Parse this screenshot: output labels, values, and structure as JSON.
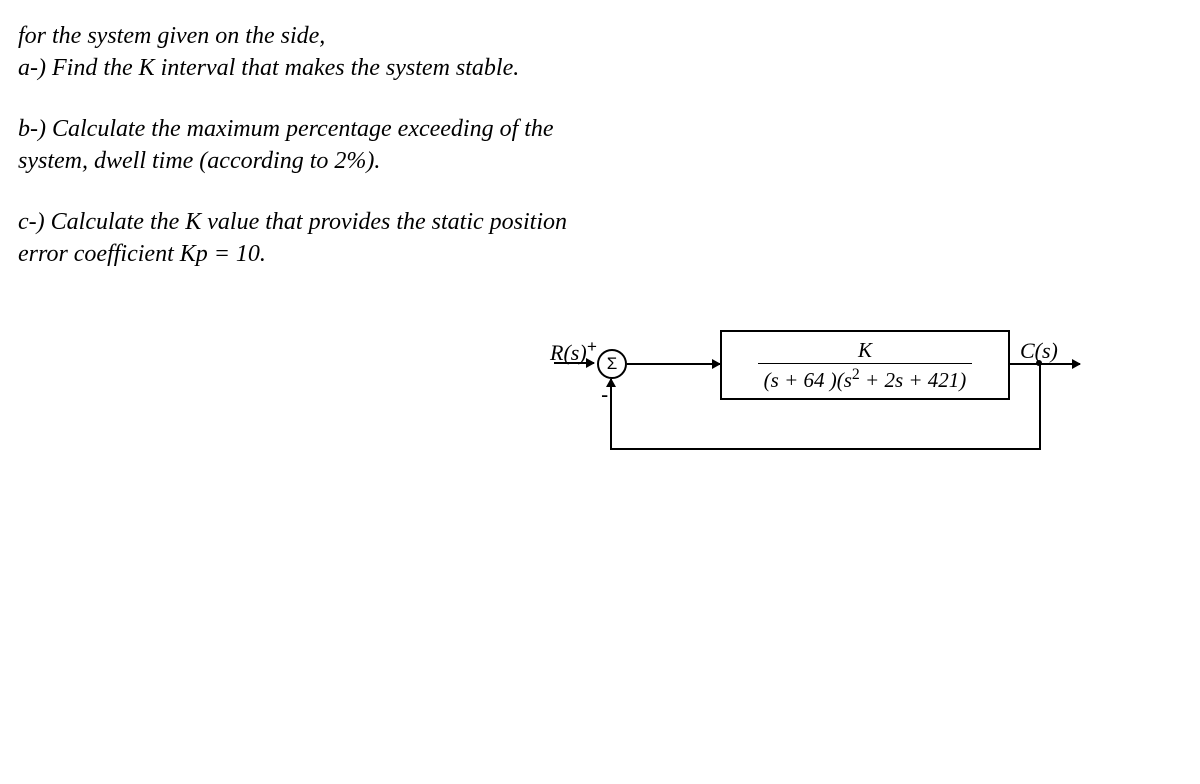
{
  "text": {
    "intro": "for the system given on the side,",
    "partA": "a-) Find the K interval that makes the system stable.",
    "partB1": "b-) Calculate the maximum percentage exceeding of the",
    "partB2": "system, dwell time (according to 2%).",
    "partC1": "c-) Calculate the K value that provides the static position",
    "partC2": "error coefficient Kp = 10."
  },
  "diagram": {
    "input_label": "R(s)",
    "output_label": "C(s)",
    "sum_symbol": "Σ",
    "plus": "+",
    "minus": "-",
    "tf_numerator": "K",
    "tf_denom_part1": "(s + 64  )(s",
    "tf_denom_sup": "2",
    "tf_denom_part2": " + 2s + 421)"
  }
}
